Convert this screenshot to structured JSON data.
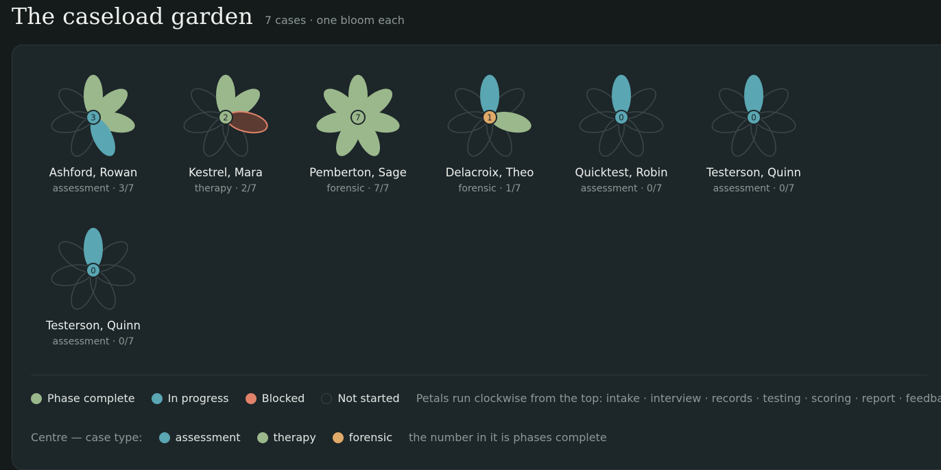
{
  "header": {
    "title": "The caseload garden",
    "subtitle": "7 cases · one bloom each"
  },
  "colors": {
    "complete": "#9bb88c",
    "in_progress": "#5aa6b3",
    "blocked": "#e0836a",
    "blocked_fill": "#5c3b33",
    "not_started_stroke": "#3a4649",
    "assessment": "#5aa6b3",
    "therapy": "#9bb88c",
    "forensic": "#e0aa68"
  },
  "cases": [
    {
      "name": "Ashford, Rowan",
      "meta": "assessment · 3/7",
      "count": "3",
      "type": "assessment",
      "petals": [
        "complete",
        "complete",
        "complete",
        "in_progress",
        "none",
        "none",
        "none"
      ]
    },
    {
      "name": "Kestrel, Mara",
      "meta": "therapy · 2/7",
      "count": "2",
      "type": "therapy",
      "petals": [
        "complete",
        "complete",
        "blocked",
        "none",
        "none",
        "none",
        "none"
      ]
    },
    {
      "name": "Pemberton, Sage",
      "meta": "forensic · 7/7",
      "count": "7",
      "type": "therapy",
      "petals": [
        "complete",
        "complete",
        "complete",
        "complete",
        "complete",
        "complete",
        "complete"
      ]
    },
    {
      "name": "Delacroix, Theo",
      "meta": "forensic · 1/7",
      "count": "1",
      "type": "forensic",
      "petals": [
        "in_progress",
        "none",
        "complete",
        "none",
        "none",
        "none",
        "none"
      ]
    },
    {
      "name": "Quicktest, Robin",
      "meta": "assessment · 0/7",
      "count": "0",
      "type": "assessment",
      "petals": [
        "in_progress",
        "none",
        "none",
        "none",
        "none",
        "none",
        "none"
      ]
    },
    {
      "name": "Testerson, Quinn",
      "meta": "assessment · 0/7",
      "count": "0",
      "type": "assessment",
      "petals": [
        "in_progress",
        "none",
        "none",
        "none",
        "none",
        "none",
        "none"
      ]
    },
    {
      "name": "Testerson, Quinn",
      "meta": "assessment · 0/7",
      "count": "0",
      "type": "assessment",
      "petals": [
        "in_progress",
        "none",
        "none",
        "none",
        "none",
        "none",
        "none"
      ]
    }
  ],
  "legend": {
    "status": [
      {
        "key": "complete",
        "label": "Phase complete"
      },
      {
        "key": "in_progress",
        "label": "In progress"
      },
      {
        "key": "blocked",
        "label": "Blocked"
      },
      {
        "key": "none",
        "label": "Not started"
      }
    ],
    "note": "Petals run clockwise from the top: intake · interview · records · testing · scoring · report · feedback",
    "type_prefix": "Centre — case type:",
    "types": [
      {
        "key": "assessment",
        "label": "assessment"
      },
      {
        "key": "therapy",
        "label": "therapy"
      },
      {
        "key": "forensic",
        "label": "forensic"
      }
    ],
    "type_note": "the number in it is phases complete"
  }
}
